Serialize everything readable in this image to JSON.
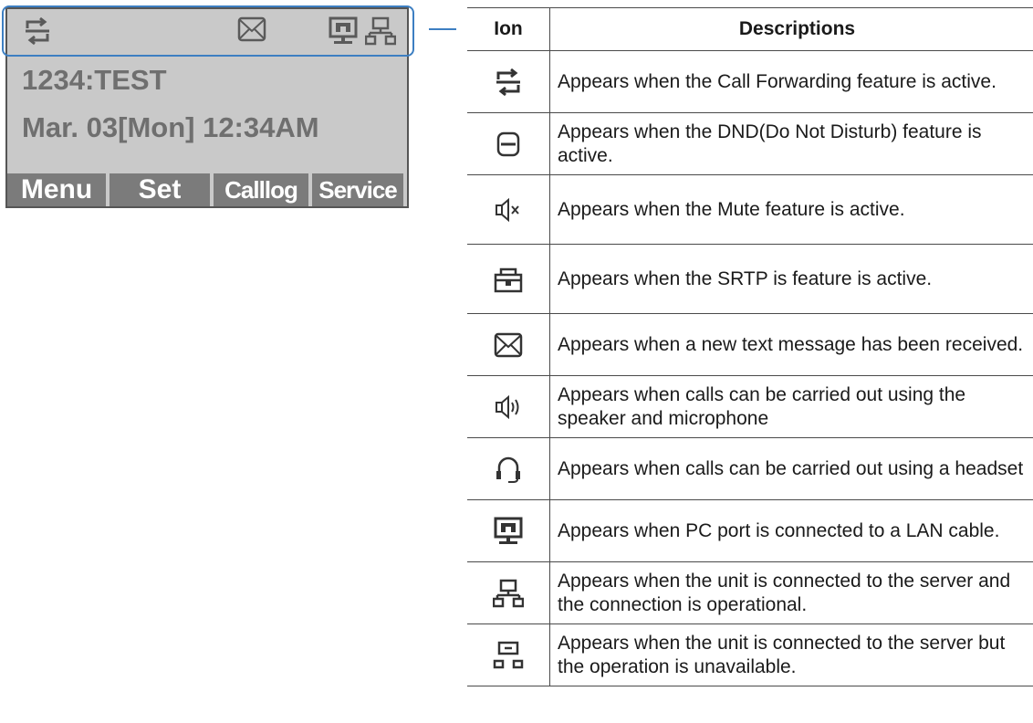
{
  "lcd": {
    "status_icons": [
      "call-forward-icon",
      "message-icon",
      "pc-port-icon",
      "server-connected-icon"
    ],
    "line1": "1234:TEST",
    "line2": "Mar. 03[Mon] 12:34AM",
    "softkeys": [
      "Menu",
      "Set",
      "Calllog",
      "Service"
    ]
  },
  "table": {
    "headers": [
      "Ion",
      "Descriptions"
    ],
    "rows": [
      {
        "icon": "call-forward-icon",
        "description": "Appears when the Call Forwarding feature is active."
      },
      {
        "icon": "dnd-icon",
        "description": "Appears when the DND(Do Not Disturb) feature is active."
      },
      {
        "icon": "mute-icon",
        "description": "Appears when the Mute feature is active."
      },
      {
        "icon": "srtp-lock-icon",
        "description": "Appears when the SRTP is feature is active."
      },
      {
        "icon": "message-icon",
        "description": "Appears when a new text message has been received."
      },
      {
        "icon": "speakerphone-icon",
        "description": "Appears when calls can be carried out using the speaker and microphone"
      },
      {
        "icon": "headset-icon",
        "description": "Appears when calls can be carried out using a headset"
      },
      {
        "icon": "pc-port-icon",
        "description": "Appears when PC port is connected to a LAN cable."
      },
      {
        "icon": "server-connected-icon",
        "description": "Appears when the unit is connected to the server and the connection is operational."
      },
      {
        "icon": "server-unavailable-icon",
        "description": "Appears when the unit is connected to the server but the operation is unavailable."
      }
    ]
  },
  "colors": {
    "lcd_background": "#c9c9c9",
    "lcd_text": "#6f6f6f",
    "softkey_background": "#7b7b7b",
    "highlight": "#3d7fc2"
  }
}
